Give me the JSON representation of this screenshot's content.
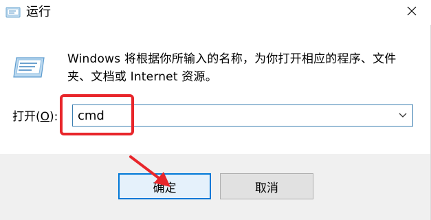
{
  "window": {
    "title": "运行",
    "close_icon": "close-icon"
  },
  "main": {
    "description": "Windows 将根据你所输入的名称，为你打开相应的程序、文件夹、文档或 Internet 资源。",
    "open_label_prefix": "打开(",
    "open_label_accel": "O",
    "open_label_suffix": "):",
    "input_value": "cmd",
    "run_icon": "run-dialog-icon",
    "dropdown_icon": "chevron-down-icon"
  },
  "footer": {
    "ok_label": "确定",
    "cancel_label": "取消"
  },
  "annotations": {
    "highlight_color": "#e8262b",
    "arrow_color": "#e8262b"
  },
  "colors": {
    "accent": "#0078d7",
    "footer_bg": "#f0f0f0"
  }
}
